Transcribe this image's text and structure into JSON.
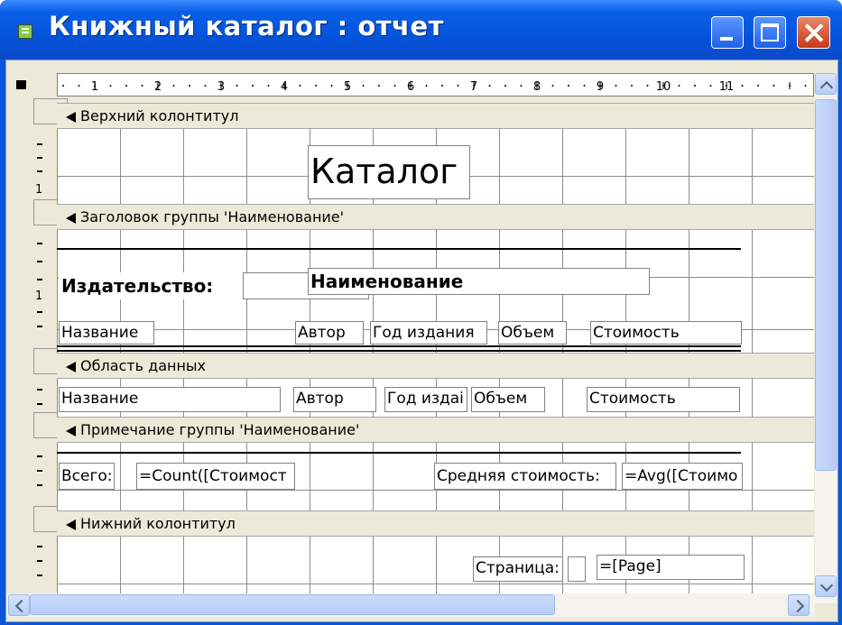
{
  "window": {
    "title": "Книжный каталог : отчет"
  },
  "sections": {
    "page_header": {
      "label": "Верхний колонтитул"
    },
    "group_header": {
      "label": "Заголовок группы 'Наименование'"
    },
    "detail": {
      "label": "Область данных"
    },
    "group_footer": {
      "label": "Примечание группы 'Наименование'"
    },
    "page_footer": {
      "label": "Нижний колонтитул"
    }
  },
  "controls": {
    "catalog_title": "Каталог",
    "publisher_label": "Издательство:",
    "name_field": "Наименование",
    "col_title": "Название",
    "col_author": "Автор",
    "col_year": "Год издания",
    "col_volume": "Объем",
    "col_price": "Стоимость",
    "det_title": "Название",
    "det_author": "Автор",
    "det_year": "Год издаі",
    "det_volume": "Объем",
    "det_price": "Стоимость",
    "total_label": "Всего:",
    "total_expr": "=Count([Стоимост",
    "avg_label": "Средняя стоимость:",
    "avg_expr": "=Avg([Стоимо",
    "page_label": "Страница:",
    "page_expr": "=[Page]"
  },
  "ruler": {
    "numbers": [
      "1",
      "2",
      "3",
      "4",
      "5",
      "6",
      "7",
      "8",
      "9",
      "10",
      "11"
    ]
  },
  "vruler": {
    "one_a": "1",
    "one_b": "1"
  }
}
